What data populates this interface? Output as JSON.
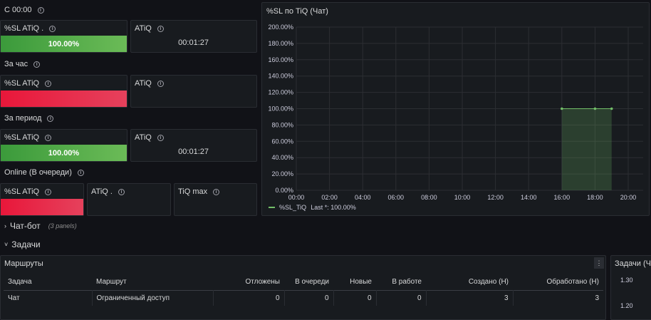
{
  "rows": {
    "r1": "С 00:00",
    "r2": "За час",
    "r3": "За период",
    "r4": "Online (В очереди)"
  },
  "stats": {
    "p1": {
      "title": "%SL ATiQ .",
      "value": "100.00%",
      "color": "#5aa64b",
      "level": 1.0
    },
    "p2": {
      "title": "ATiQ",
      "value": "00:01:27"
    },
    "p3": {
      "title": "%SL ATiQ",
      "value": "",
      "color": "#e8173a"
    },
    "p4": {
      "title": "ATiQ",
      "value": ""
    },
    "p5": {
      "title": "%SL ATiQ",
      "value": "100.00%",
      "color": "#5aa64b",
      "level": 1.0
    },
    "p6": {
      "title": "ATiQ",
      "value": "00:01:27"
    },
    "p7": {
      "title": "%SL ATiQ",
      "value": "",
      "color": "#e8173a"
    },
    "p8": {
      "title": "ATiQ .",
      "value": ""
    },
    "p9": {
      "title": "TiQ max",
      "value": ""
    }
  },
  "chart_panel": {
    "title": "%SL по TiQ (Чат)",
    "legend_name": "%SL_TiQ",
    "legend_last": "Last *: 100.00%"
  },
  "chart_data": {
    "type": "area",
    "title": "%SL по TiQ (Чат)",
    "x_ticks": [
      "00:00",
      "02:00",
      "04:00",
      "06:00",
      "08:00",
      "10:00",
      "12:00",
      "14:00",
      "16:00",
      "18:00",
      "20:00"
    ],
    "y_ticks": [
      "0.00%",
      "20.00%",
      "40.00%",
      "60.00%",
      "80.00%",
      "100.00%",
      "120.00%",
      "140.00%",
      "160.00%",
      "180.00%",
      "200.00%"
    ],
    "xlim": [
      0,
      20.9
    ],
    "ylim": [
      0,
      200
    ],
    "grid": true,
    "legend_position": "bottom-left",
    "series": [
      {
        "name": "%SL_TiQ",
        "color": "#73bf69",
        "x": [
          16,
          18,
          19
        ],
        "y": [
          100,
          100,
          100
        ]
      }
    ]
  },
  "sections": {
    "chatbot": "Чат-бот",
    "chatbot_count": "(3 panels)",
    "tasks": "Задачи"
  },
  "routes": {
    "title": "Маршруты",
    "columns": [
      "Задача",
      "Маршрут",
      "Отложены",
      "В очереди",
      "Новые",
      "В работе",
      "Создано (Н)",
      "Обработано (Н)"
    ],
    "rows": [
      [
        "Чат",
        "Ограниченный доступ",
        "0",
        "0",
        "0",
        "0",
        "3",
        "3"
      ]
    ]
  },
  "tasks_panel": {
    "title": "Задачи (Ча",
    "ticks": [
      "1.30",
      "1.20"
    ]
  }
}
